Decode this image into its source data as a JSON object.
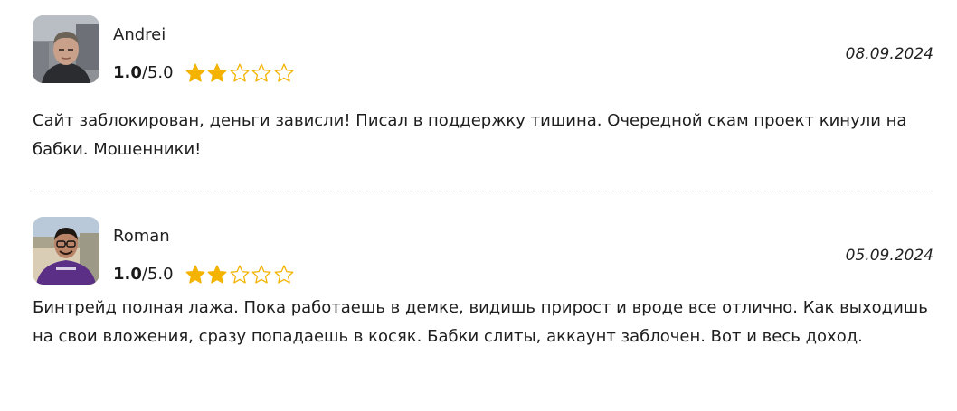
{
  "reviews": [
    {
      "author": "Andrei",
      "score": "1.0",
      "score_max": "/5.0",
      "stars_filled": 2,
      "stars_total": 5,
      "date": "08.09.2024",
      "text": "Сайт заблокирован, деньги зависли! Писал в поддержку тишина. Очередной скам проект кинули на бабки. Мошенники!",
      "avatar_icon": "user-photo-icon"
    },
    {
      "author": "Roman",
      "score": "1.0",
      "score_max": "/5.0",
      "stars_filled": 2,
      "stars_total": 5,
      "date": "05.09.2024",
      "text": "Бинтрейд полная лажа. Пока работаешь в демке, видишь прирост и вроде все отлично. Как выходишь на свои вложения, сразу попадаешь в косяк. Бабки слиты, аккаунт заблочен. Вот и весь доход.",
      "avatar_icon": "user-photo-icon"
    }
  ],
  "colors": {
    "star": "#f5b301",
    "divider": "#9a9a9a"
  }
}
